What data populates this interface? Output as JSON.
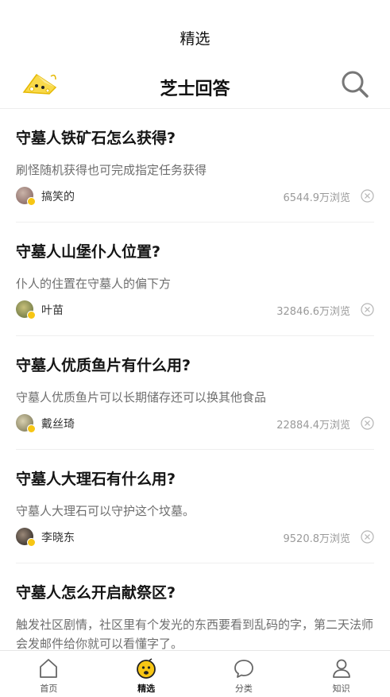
{
  "status_bar": {
    "title": "精选"
  },
  "header": {
    "title": "芝士回答",
    "logo_icon": "cheese-logo-icon",
    "search_icon": "search-icon"
  },
  "feed": {
    "items": [
      {
        "title": "守墓人铁矿石怎么获得?",
        "answer": "刷怪随机获得也可完成指定任务获得",
        "author": "搞笑的",
        "views": "6544.9万浏览"
      },
      {
        "title": "守墓人山堡仆人位置?",
        "answer": "仆人的住置在守墓人的偏下方",
        "author": "叶苗",
        "views": "32846.6万浏览"
      },
      {
        "title": "守墓人优质鱼片有什么用?",
        "answer": "守墓人优质鱼片可以长期储存还可以换其他食品",
        "author": "戴丝琦",
        "views": "22884.4万浏览"
      },
      {
        "title": "守墓人大理石有什么用?",
        "answer": "守墓人大理石可以守护这个坟墓。",
        "author": "李晓东",
        "views": "9520.8万浏览"
      },
      {
        "title": "守墓人怎么开启献祭区?",
        "answer": "触发社区剧情，社区里有个发光的东西要看到乱码的字，第二天法师会发邮件给你就可以看懂字了。"
      }
    ]
  },
  "tabbar": {
    "tabs": [
      {
        "label": "首页",
        "icon": "home-icon"
      },
      {
        "label": "精选",
        "icon": "cheese-face-icon",
        "active": true
      },
      {
        "label": "分类",
        "icon": "chat-bubble-icon"
      },
      {
        "label": "知识",
        "icon": "person-icon"
      }
    ]
  },
  "colors": {
    "accent": "#f7c614",
    "title_text": "#151515",
    "muted_text": "#6e6e6e",
    "views_text": "#9a9a9a",
    "divider": "#efefef"
  }
}
